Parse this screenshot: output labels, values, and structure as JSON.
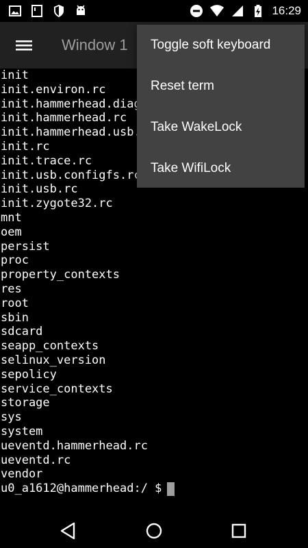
{
  "status_bar": {
    "time": "16:29",
    "left_icons": [
      "image-icon",
      "sim-card-icon",
      "shield-icon",
      "android-icon"
    ],
    "right_icons": [
      "do-not-disturb-icon",
      "wifi-icon",
      "signal-icon",
      "battery-charging-icon"
    ]
  },
  "app_bar": {
    "title": "Window 1"
  },
  "overflow_menu": {
    "items": [
      "Toggle soft keyboard",
      "Reset term",
      "Take WakeLock",
      "Take WifiLock"
    ]
  },
  "terminal": {
    "lines": [
      "init",
      "init.environ.rc",
      "init.hammerhead.diag.rc",
      "init.hammerhead.rc",
      "init.hammerhead.usb.rc",
      "init.rc",
      "init.trace.rc",
      "init.usb.configfs.rc",
      "init.usb.rc",
      "init.zygote32.rc",
      "mnt",
      "oem",
      "persist",
      "proc",
      "property_contexts",
      "res",
      "root",
      "sbin",
      "sdcard",
      "seapp_contexts",
      "selinux_version",
      "sepolicy",
      "service_contexts",
      "storage",
      "sys",
      "system",
      "ueventd.hammerhead.rc",
      "ueventd.rc",
      "vendor"
    ],
    "prompt": "u0_a1612@hammerhead:/ $"
  },
  "colors": {
    "app_bar_bg": "#212121",
    "menu_bg": "#424242",
    "terminal_fg": "#ffffff",
    "terminal_bg": "#000000",
    "cursor": "#9e9e9e"
  }
}
